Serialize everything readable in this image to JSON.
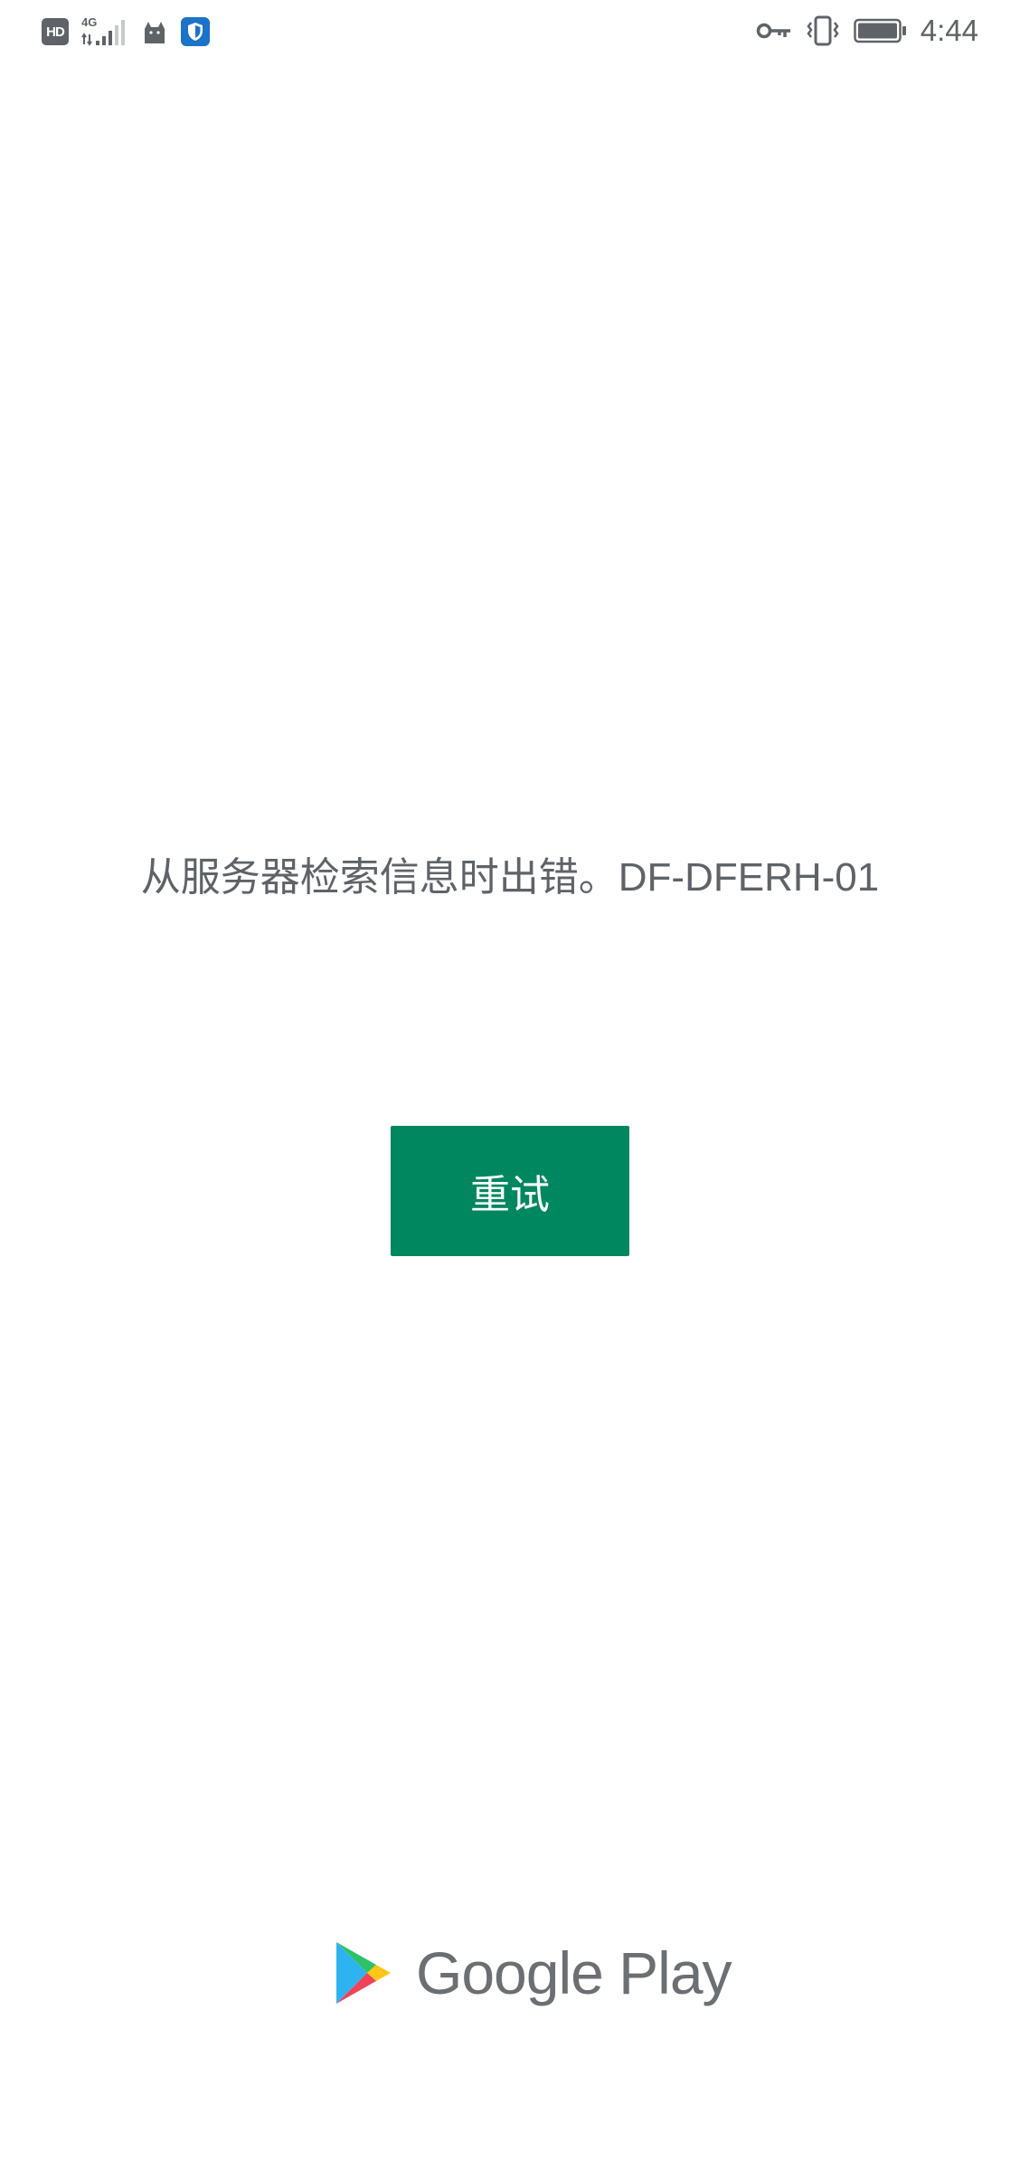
{
  "status_bar": {
    "hd_label": "HD",
    "network_type": "4G",
    "time": "4:44",
    "icons": [
      "hd-badge-icon",
      "cellular-signal-icon",
      "cat-icon",
      "shield-icon",
      "vpn-key-icon",
      "vibrate-icon",
      "battery-icon"
    ]
  },
  "error": {
    "message": "从服务器检索信息时出错。DF-DFERH-01"
  },
  "retry": {
    "label": "重试"
  },
  "footer": {
    "brand": "Google Play",
    "icon": "google-play-triangle-icon"
  },
  "colors": {
    "accent": "#01875f",
    "text": "#5f6368",
    "background": "#ffffff"
  }
}
